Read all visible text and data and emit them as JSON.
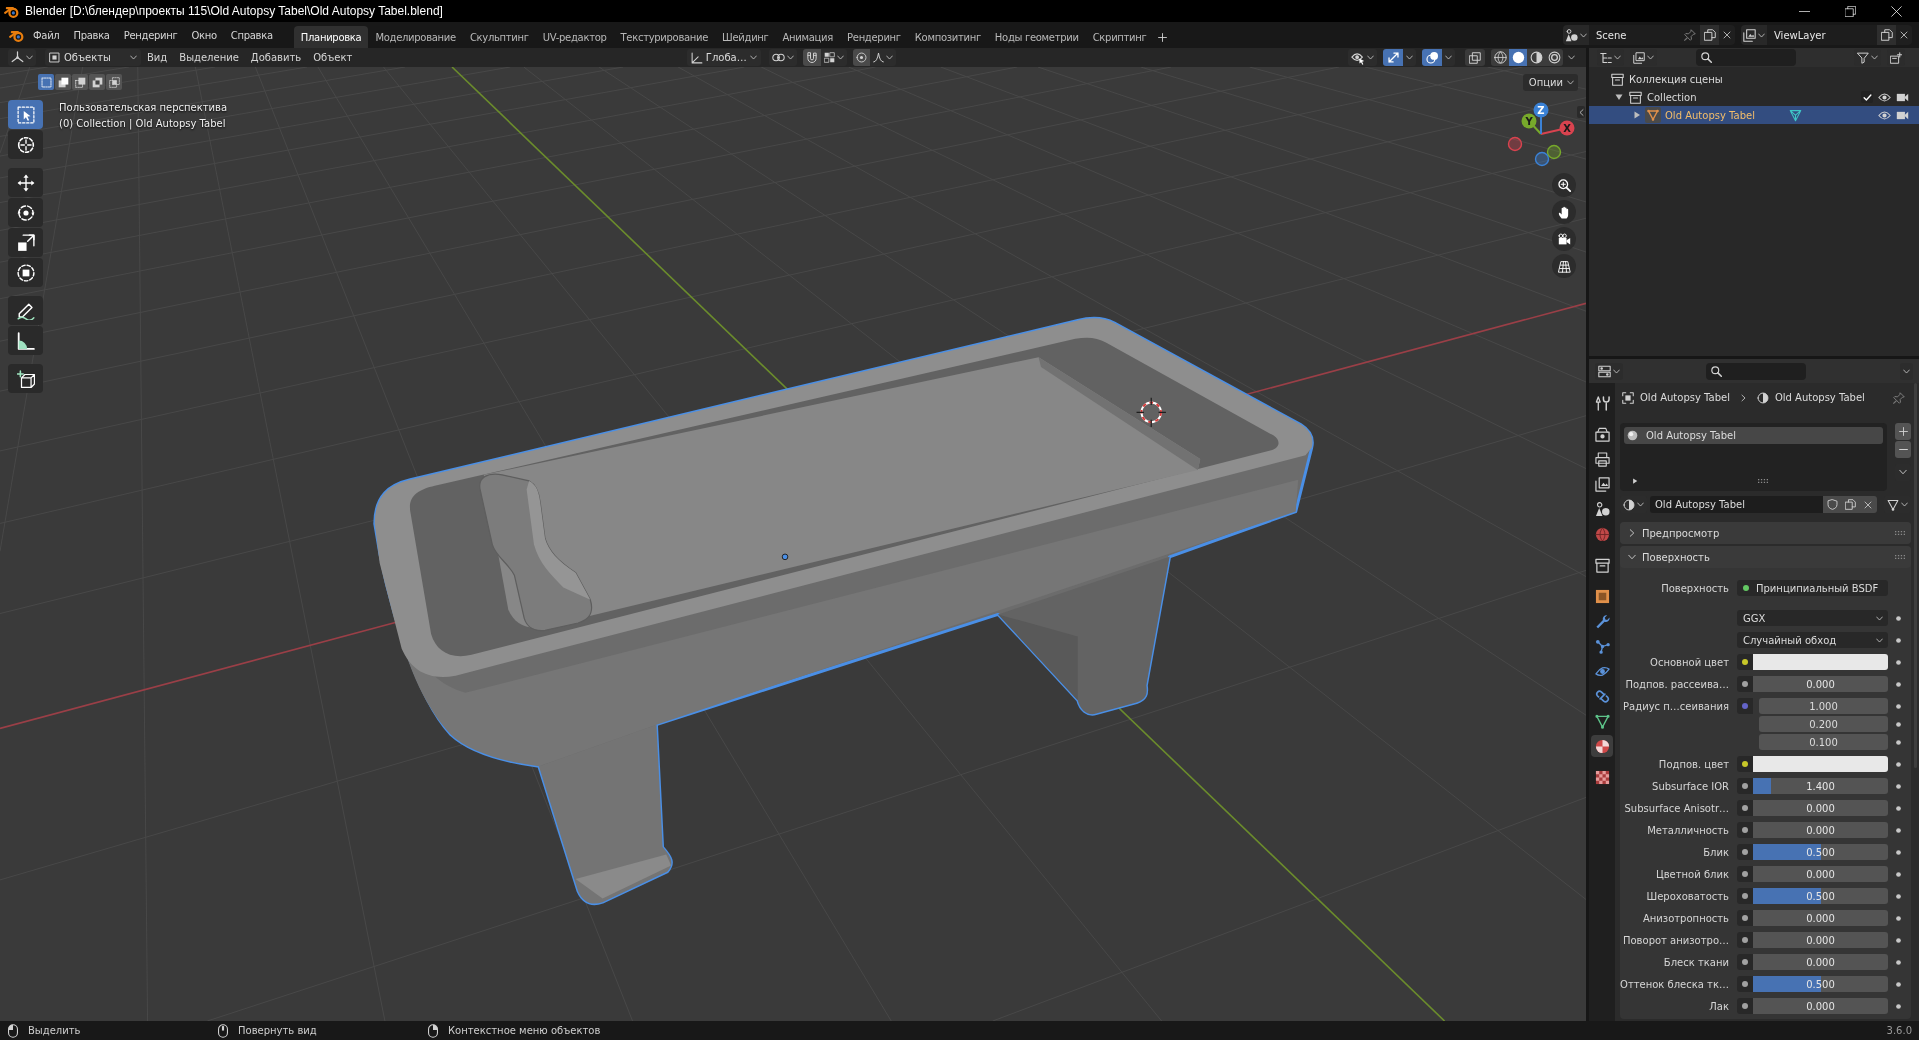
{
  "window": {
    "title": "Blender [D:\\блендер\\проекты 115\\Old Autopsy Tabel\\Old Autopsy Tabel.blend]"
  },
  "menu": [
    "Файл",
    "Правка",
    "Рендеринг",
    "Окно",
    "Справка"
  ],
  "workspaces": [
    {
      "label": "Планировка",
      "selected": true
    },
    {
      "label": "Моделирование",
      "selected": false
    },
    {
      "label": "Скульптинг",
      "selected": false
    },
    {
      "label": "UV-редактор",
      "selected": false
    },
    {
      "label": "Текстурирование",
      "selected": false
    },
    {
      "label": "Шейдинг",
      "selected": false
    },
    {
      "label": "Анимация",
      "selected": false
    },
    {
      "label": "Рендеринг",
      "selected": false
    },
    {
      "label": "Композитинг",
      "selected": false
    },
    {
      "label": "Ноды геометрии",
      "selected": false
    },
    {
      "label": "Скриптинг",
      "selected": false
    }
  ],
  "scene": {
    "name": "Scene"
  },
  "view_layer": {
    "name": "ViewLayer"
  },
  "viewport": {
    "header": {
      "mode": "Объекты",
      "menus": [
        "Вид",
        "Выделение",
        "Добавить",
        "Объект"
      ],
      "orientation": "Глоба…",
      "gizmos": {
        "on": true
      },
      "overlays": {
        "on": true
      },
      "xray": {
        "on": false
      },
      "shading_modes": [
        {
          "selected": false
        },
        {
          "selected": true
        },
        {
          "selected": false
        },
        {
          "selected": false
        }
      ]
    },
    "options": "Опции",
    "select_modes": [
      {
        "selected": true
      },
      {
        "selected": false
      },
      {
        "selected": false
      },
      {
        "selected": false
      },
      {
        "selected": false
      }
    ],
    "tools": [
      {
        "selected": true
      },
      {
        "selected": false
      },
      {
        "selected": false
      },
      {
        "selected": false
      },
      {
        "selected": false
      },
      {
        "selected": false
      },
      {
        "selected": false
      },
      {
        "selected": false
      },
      {
        "selected": false
      }
    ],
    "info": [
      "Пользовательская перспектива",
      "(0) Collection | Old Autopsy Tabel"
    ],
    "axis_labels": [
      "X",
      "Y",
      "Z"
    ]
  },
  "outliner": {
    "tree": [
      {
        "kind": "scene_collection",
        "label": "Коллекция сцены",
        "selected": false,
        "children": [
          {
            "kind": "collection",
            "label": "Collection",
            "expanded": true,
            "checked": true,
            "selected": false,
            "children": [
              {
                "kind": "object",
                "label": "Old Autopsy Tabel",
                "expanded": false,
                "selected": true
              }
            ]
          }
        ]
      }
    ]
  },
  "properties": {
    "tabs": [
      {
        "selected": false
      },
      {
        "selected": false
      },
      {
        "selected": false
      },
      {
        "selected": false
      },
      {
        "selected": false
      },
      {
        "selected": false
      },
      {
        "selected": false
      },
      {
        "selected": false
      },
      {
        "selected": false
      },
      {
        "selected": false
      },
      {
        "selected": false
      },
      {
        "selected": false
      },
      {
        "selected": false
      },
      {
        "selected": true
      },
      {
        "selected": false
      }
    ],
    "breadcrumb": [
      "Old Autopsy Tabel",
      "Old Autopsy Tabel"
    ],
    "material_slots": [
      {
        "label": "Old Autopsy Tabel",
        "selected": true
      }
    ],
    "material": "Old Autopsy Tabel",
    "panels": [
      {
        "title": "Предпросмотр",
        "expanded": false
      },
      {
        "title": "Поверхность",
        "expanded": true,
        "rows": [
          {
            "kind": "shader",
            "label": "Поверхность",
            "value": "Принципиальный BSDF",
            "color": "#63c763"
          },
          {
            "kind": "dropdown",
            "value": "GGX"
          },
          {
            "kind": "dropdown",
            "value": "Случайный обход"
          },
          {
            "kind": "color",
            "label": "Основной цвет",
            "color": "#c7c729"
          },
          {
            "kind": "number",
            "label": "Подпов. рассеива…",
            "color": "#a1a1a1",
            "value": "0.000"
          },
          {
            "kind": "vector",
            "label": "Радиус п…сеивания",
            "color": "#6363c7",
            "values": [
              "1.000",
              "0.200",
              "0.100"
            ]
          },
          {
            "kind": "color",
            "label": "Подпов. цвет",
            "color": "#c7c729"
          },
          {
            "kind": "slider",
            "label": "Subsurface IOR",
            "color": "#a1a1a1",
            "value": "1.400",
            "level": 0.13
          },
          {
            "kind": "number",
            "label": "Subsurface Anisotr…",
            "color": "#a1a1a1",
            "value": "0.000"
          },
          {
            "kind": "number",
            "label": "Металличность",
            "color": "#a1a1a1",
            "value": "0.000"
          },
          {
            "kind": "slider",
            "label": "Блик",
            "color": "#a1a1a1",
            "value": "0.500",
            "level": 0.5
          },
          {
            "kind": "number",
            "label": "Цветной блик",
            "color": "#a1a1a1",
            "value": "0.000"
          },
          {
            "kind": "slider",
            "label": "Шероховатость",
            "color": "#a1a1a1",
            "value": "0.500",
            "level": 0.5
          },
          {
            "kind": "number",
            "label": "Анизотропность",
            "color": "#a1a1a1",
            "value": "0.000"
          },
          {
            "kind": "number",
            "label": "Поворот анизотро…",
            "color": "#a1a1a1",
            "value": "0.000"
          },
          {
            "kind": "number",
            "label": "Блеск ткани",
            "color": "#a1a1a1",
            "value": "0.000"
          },
          {
            "kind": "slider",
            "label": "Оттенок блеска тк…",
            "color": "#a1a1a1",
            "value": "0.500",
            "level": 0.5
          },
          {
            "kind": "number",
            "label": "Лак",
            "color": "#a1a1a1",
            "value": "0.000"
          }
        ]
      }
    ]
  },
  "status_bar": {
    "hints": [
      "Выделить",
      "Повернуть вид",
      "Контекстное меню объектов"
    ],
    "version": "3.6.0"
  }
}
